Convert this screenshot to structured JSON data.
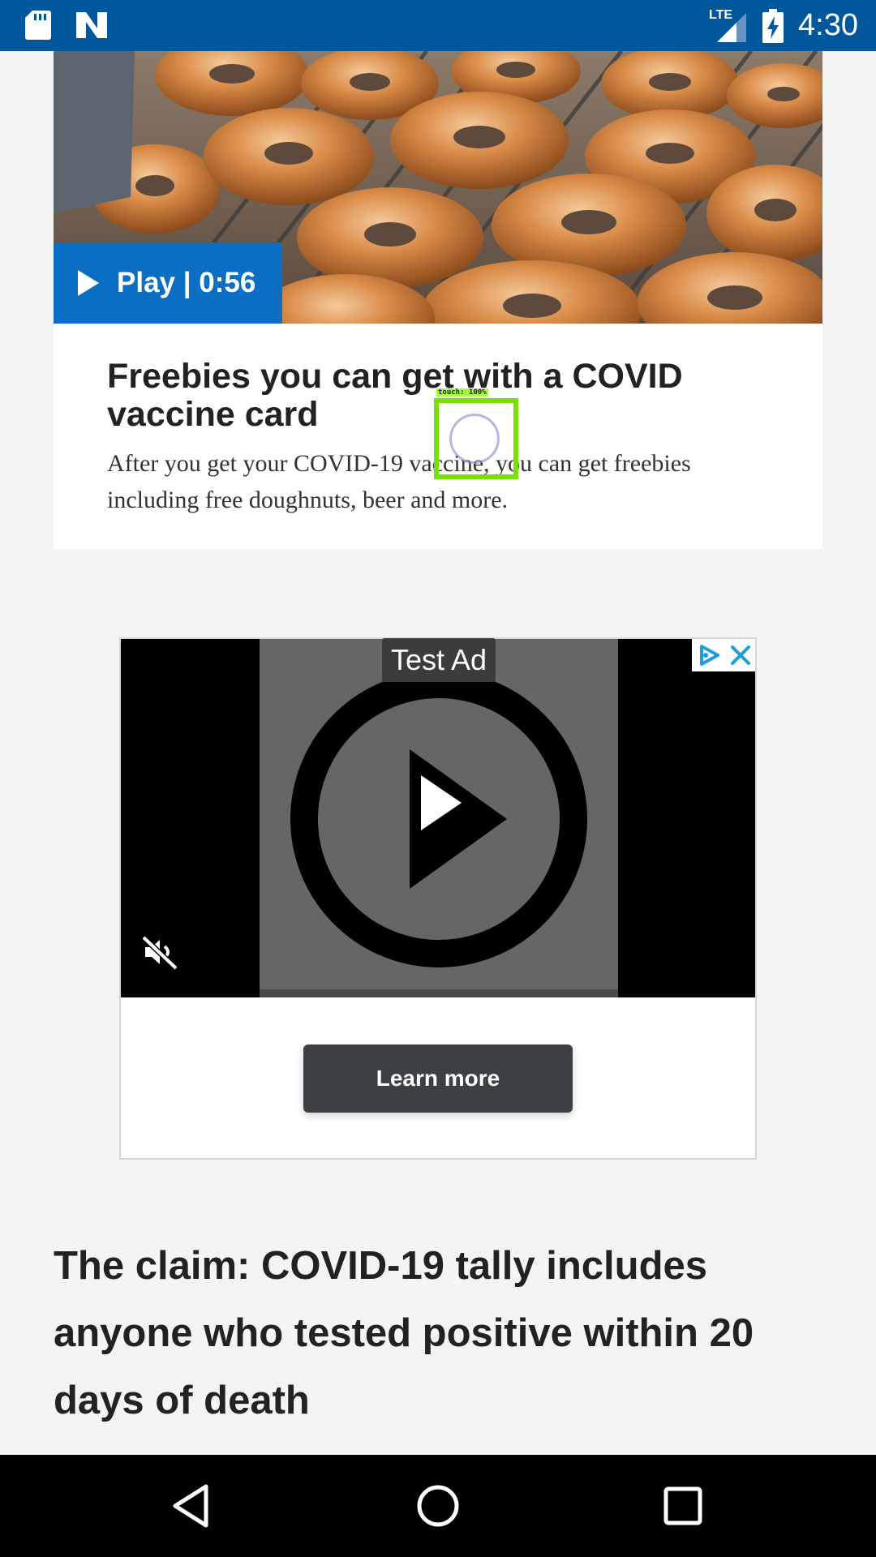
{
  "status_bar": {
    "time": "4:30",
    "network": "LTE",
    "icons": [
      "sd-card-icon",
      "n-notification-icon",
      "lte-signal-icon",
      "battery-charging-icon"
    ]
  },
  "article_card": {
    "play_label": "Play | 0:56",
    "title": "Freebies you can get with a COVID vaccine card",
    "description": "After you get your COVID-19 vaccine, you can get freebies including free doughnuts, beer and more."
  },
  "ad": {
    "test_label": "Test Ad",
    "learn_more_label": "Learn more",
    "icons": [
      "adchoices-icon",
      "close-icon",
      "mute-icon",
      "play-icon"
    ]
  },
  "headline": "The claim: COVID-19 tally includes anyone who tested positive within 20 days of death",
  "touch_overlay": {
    "label": "touch: 100%"
  },
  "navigation": {
    "icons": [
      "back-icon",
      "home-icon",
      "recents-icon"
    ]
  },
  "colors": {
    "status_bar": "#01579b",
    "play_pill": "#0a6fc2",
    "learn_more_button": "#3c4043",
    "touch_box": "#76e000",
    "adchoices_blue": "#1a9fd9"
  }
}
